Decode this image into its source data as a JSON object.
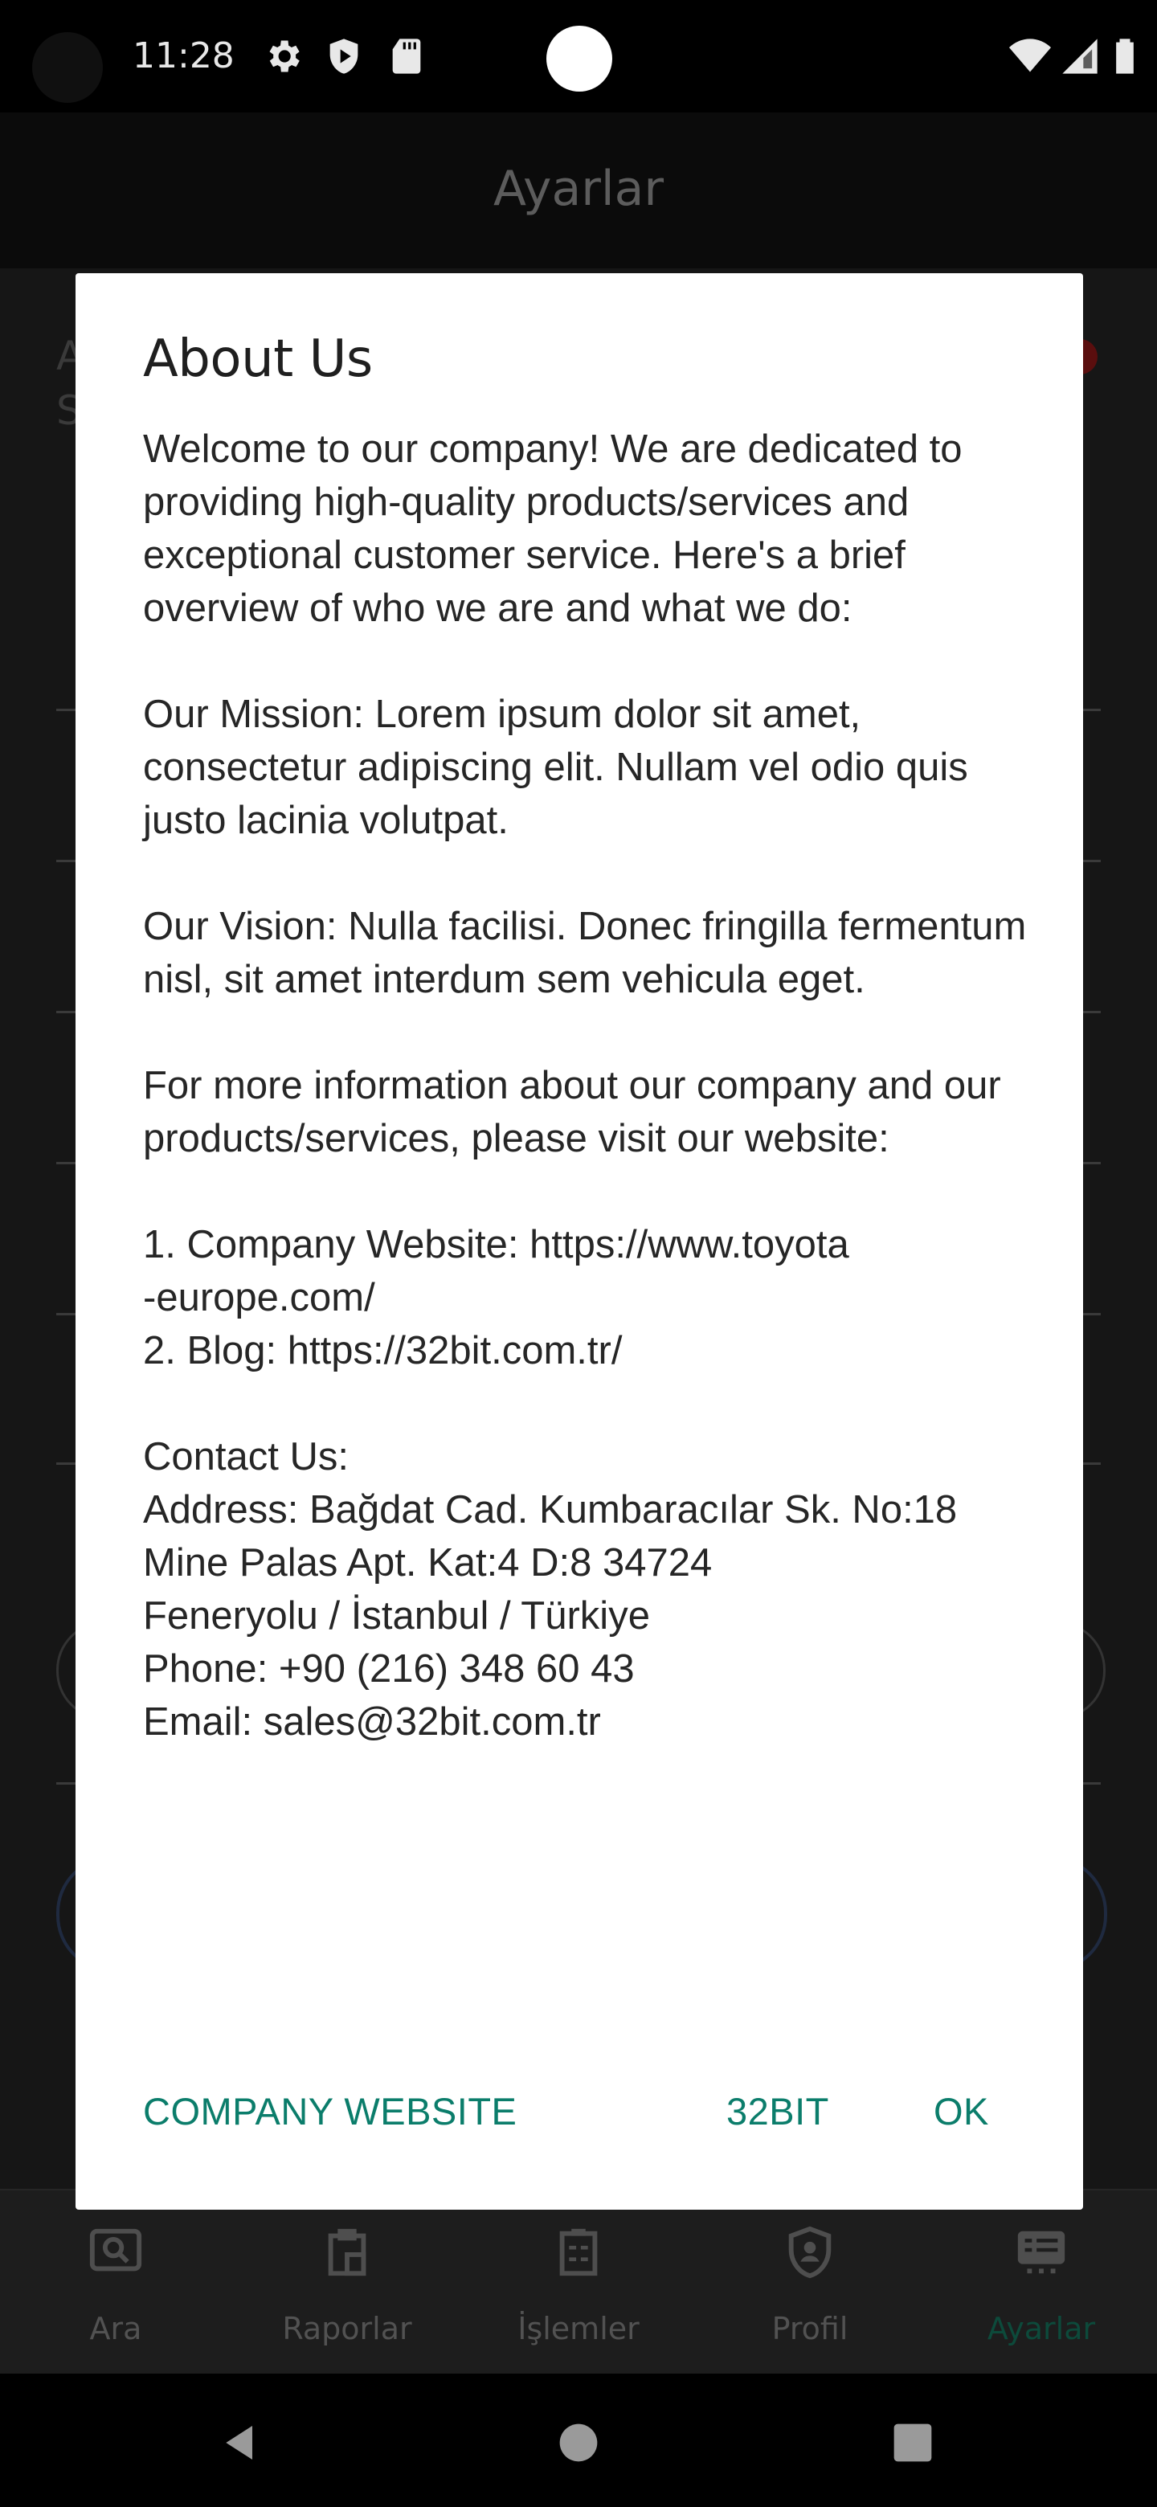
{
  "status_bar": {
    "time": "11:28"
  },
  "app_bar": {
    "title": "Ayarlar"
  },
  "background": {
    "letter_a": "A",
    "letter_s": "S"
  },
  "dialog": {
    "title": "About Us",
    "body": "Welcome to our company! We are dedicated to providing high-quality products/services and exceptional customer service. Here's a brief overview of who we are and what we do:\n\nOur Mission: Lorem ipsum dolor sit amet, consectetur adipiscing elit. Nullam vel odio quis justo lacinia volutpat.\n\nOur Vision: Nulla facilisi. Donec fringilla fermentum nisl, sit amet interdum sem vehicula eget.\n\nFor more information about our company and our products/services, please visit our website:\n\n1. Company Website: https://www.toyota\n-europe.com/\n2. Blog: https://32bit.com.tr/\n\nContact Us:\nAddress: Bağdat Cad. Kumbaracılar Sk. No:18\nMine Palas Apt. Kat:4 D:8 34724\nFeneryolu / İstanbul / Türkiye\nPhone: +90 (216) 348 60 43\nEmail: sales@32bit.com.tr",
    "buttons": {
      "company_website": "COMPANY WEBSITE",
      "blog": "32BIT",
      "ok": "OK"
    }
  },
  "bottom_nav": {
    "items": [
      {
        "label": "Ara",
        "icon": "search-icon"
      },
      {
        "label": "Raporlar",
        "icon": "reports-icon"
      },
      {
        "label": "İşlemler",
        "icon": "transactions-icon"
      },
      {
        "label": "Profil",
        "icon": "profile-shield-icon"
      },
      {
        "label": "Ayarlar",
        "icon": "settings-list-icon",
        "active": true
      }
    ]
  },
  "colors": {
    "accent": "#0b7d6b",
    "dialog_bg": "#ffffff",
    "scrim": "#1b1b1b"
  }
}
